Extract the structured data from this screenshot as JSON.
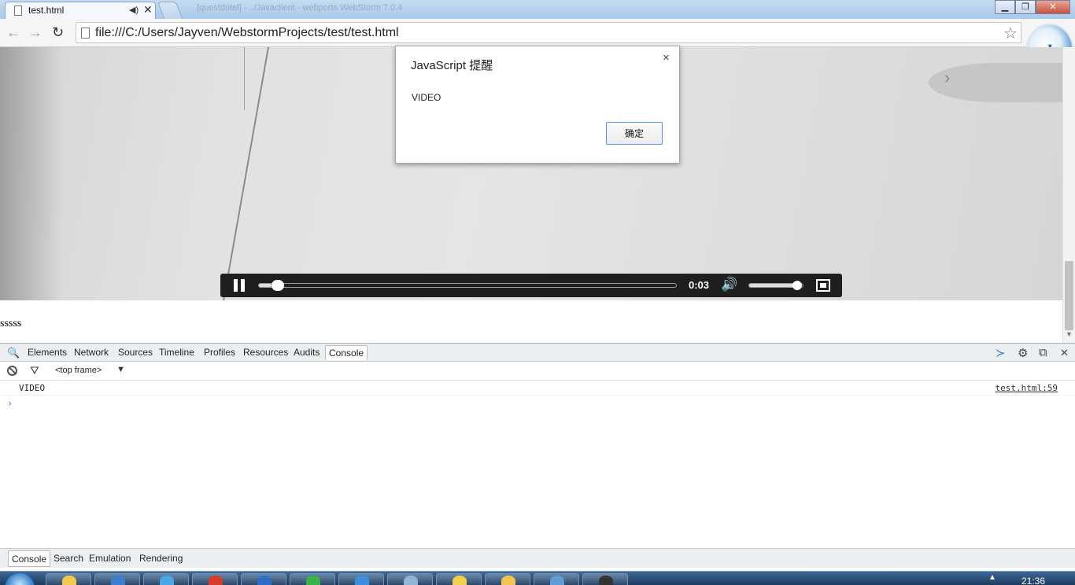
{
  "browser": {
    "tab_title": "test.html",
    "tab_audio_icon": "speaker-icon",
    "tab_close": "✕",
    "ghost_window_title": "[questdotel] - ../Javaclient - webports WebStorm 7.0.4",
    "window_buttons": {
      "minimize": "▁",
      "restore": "❐",
      "close": "✕"
    },
    "url": "file:///C:/Users/Jayven/WebstormProjects/test/test.html",
    "icons": {
      "back": "←",
      "forward": "→",
      "reload": "↻",
      "star": "☆",
      "extension_bird": "➶"
    }
  },
  "video": {
    "time": "0:03",
    "progress_fraction": 0.03,
    "volume_fraction": 0.9,
    "icons": {
      "play_pause": "pause-icon",
      "volume": "🔊",
      "fullscreen": "fullscreen-icon",
      "overlay_arrow": "›"
    }
  },
  "page": {
    "text": "sssss"
  },
  "alert": {
    "title": "JavaScript 提醒",
    "close": "×",
    "message": "VIDEO",
    "ok_label": "确定"
  },
  "devtools": {
    "search_icon": "🔍",
    "tabs": [
      "Elements",
      "Network",
      "Sources",
      "Timeline",
      "Profiles",
      "Resources",
      "Audits",
      "Console"
    ],
    "selected_tab": "Console",
    "right_icons": {
      "exec": "≻",
      "gear": "⚙",
      "dock": "⧉",
      "close": "✕"
    },
    "console_toolbar": {
      "filter_icon": "⛛",
      "frame": "<top frame>",
      "caret": "▼"
    },
    "console_rows": [
      {
        "message": "VIDEO",
        "source": "test.html:59"
      }
    ],
    "prompt": "›",
    "drawer_tabs": [
      "Console",
      "Search",
      "Emulation",
      "Rendering"
    ],
    "selected_drawer_tab": "Console"
  },
  "taskbar": {
    "clock": "21:36",
    "tray_arrow": "▲",
    "item_colors": [
      "#f4c84a",
      "#3c7fd0",
      "#46a8e6",
      "#d93b2b",
      "#2f6ec8",
      "#37b34a",
      "#3c8fe0",
      "#8fb4d8",
      "#f2d14a",
      "#f3c44f",
      "#5f9bd4",
      "#333333"
    ]
  }
}
